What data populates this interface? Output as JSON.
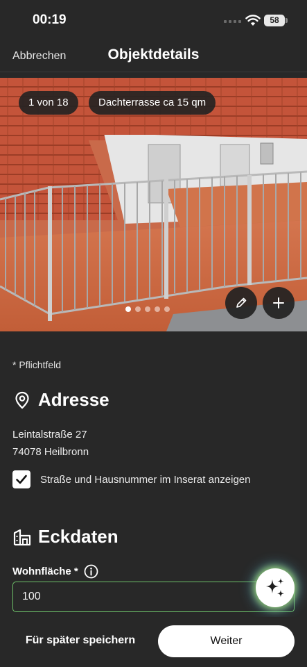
{
  "status_bar": {
    "time": "00:19",
    "battery": "58"
  },
  "nav": {
    "cancel_label": "Abbrechen",
    "title": "Objektdetails"
  },
  "photo": {
    "counter": "1 von 18",
    "caption": "Dachterrasse ca 15 qm",
    "dots_total": 5,
    "dots_active_index": 0
  },
  "form": {
    "required_note": "* Pflichtfeld",
    "address": {
      "heading": "Adresse",
      "street": "Leintalstraße 27",
      "city": "74078 Heilbronn",
      "show_address_label": "Straße und Hausnummer im Inserat anzeigen",
      "show_address_checked": true
    },
    "key_data": {
      "heading": "Eckdaten",
      "living_area_label": "Wohnfläche *",
      "living_area_value": "100"
    }
  },
  "footer": {
    "save_later_label": "Für später speichern",
    "next_label": "Weiter"
  },
  "colors": {
    "background": "#282828",
    "input_border": "#6ec26a",
    "tile_roof": "#c4543a"
  },
  "icons": {
    "status": [
      "wifi-icon",
      "battery-icon"
    ],
    "photo": [
      "pencil-icon",
      "plus-icon"
    ],
    "sections": [
      "location-pin-icon",
      "building-icon"
    ],
    "field": [
      "info-icon"
    ],
    "fab": [
      "sparkles-icon"
    ]
  }
}
